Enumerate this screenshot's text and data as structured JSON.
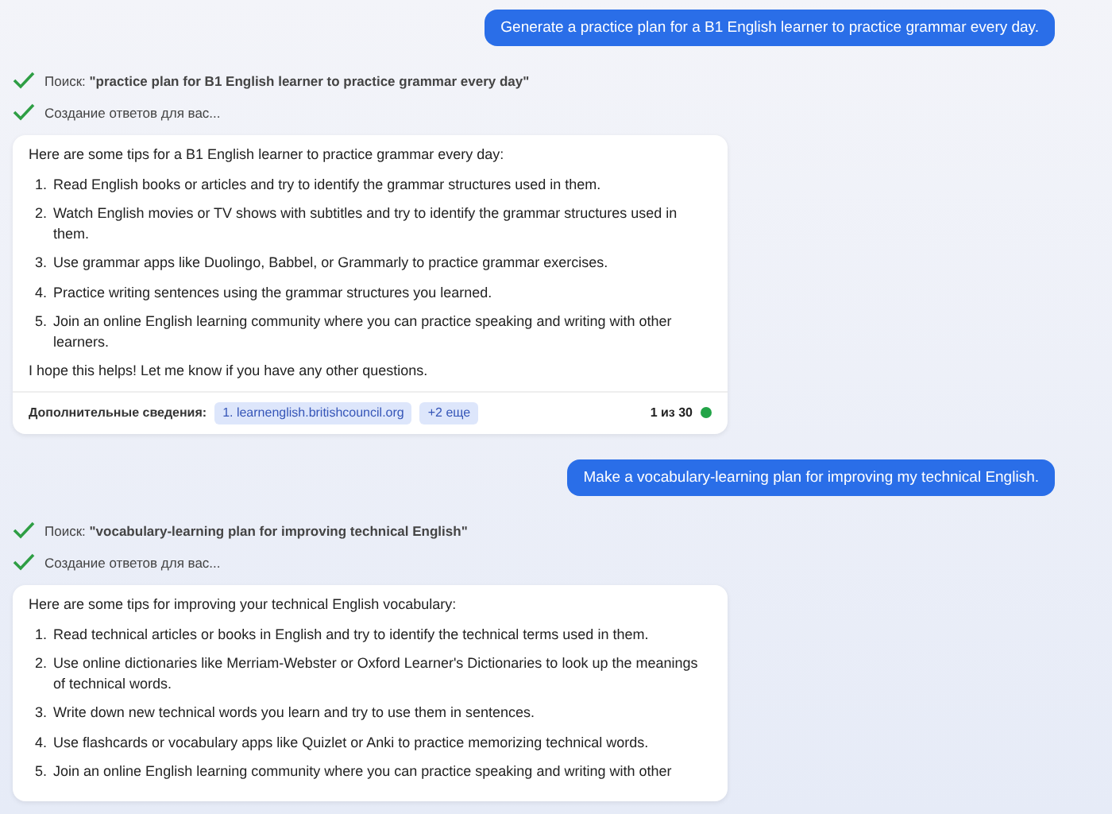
{
  "conversation": [
    {
      "kind": "user",
      "text": "Generate a practice plan for a B1 English learner to practice grammar every day."
    },
    {
      "kind": "status",
      "label": "Поиск: ",
      "query": "\"practice plan for B1 English learner to practice grammar every day\""
    },
    {
      "kind": "status",
      "label": "Создание ответов для вас..."
    },
    {
      "kind": "answer",
      "intro": "Here are some tips for a B1 English learner to practice grammar every day:",
      "items": [
        {
          "number": "1.",
          "text": "Read English books or articles and try to identify the grammar structures used in them."
        },
        {
          "number": "2.",
          "text": "Watch English movies or TV shows with subtitles and try to identify the grammar structures used in them."
        },
        {
          "number": "3.",
          "text": "Use grammar apps like Duolingo, Babbel, or Grammarly to practice grammar exercises."
        },
        {
          "number": "4.",
          "text": "Practice writing sentences using the grammar structures you learned."
        },
        {
          "number": "5.",
          "text": "Join an online English learning community where you can practice speaking and writing with other learners."
        }
      ],
      "outro": "I hope this helps! Let me know if you have any other questions.",
      "footer": {
        "label": "Дополнительные сведения:",
        "links": [
          "1. learnenglish.britishcouncil.org",
          "+2 еще"
        ],
        "count": "1 из 30"
      }
    },
    {
      "kind": "user",
      "text": "Make a vocabulary-learning plan for improving my technical English."
    },
    {
      "kind": "status",
      "label": "Поиск: ",
      "query": "\"vocabulary-learning plan for improving technical English\""
    },
    {
      "kind": "status",
      "label": "Создание ответов для вас..."
    },
    {
      "kind": "answer",
      "intro": "Here are some tips for improving your technical English vocabulary:",
      "items": [
        {
          "number": "1.",
          "text": "Read technical articles or books in English and try to identify the technical terms used in them."
        },
        {
          "number": "2.",
          "text": "Use online dictionaries like Merriam-Webster or Oxford Learner's Dictionaries to look up the meanings of technical words."
        },
        {
          "number": "3.",
          "text": "Write down new technical words you learn and try to use them in sentences."
        },
        {
          "number": "4.",
          "text": "Use flashcards or vocabulary apps like Quizlet or Anki to practice memorizing technical words."
        },
        {
          "number": "5.",
          "text": "Join an online English learning community where you can practice speaking and writing with other"
        }
      ]
    }
  ]
}
